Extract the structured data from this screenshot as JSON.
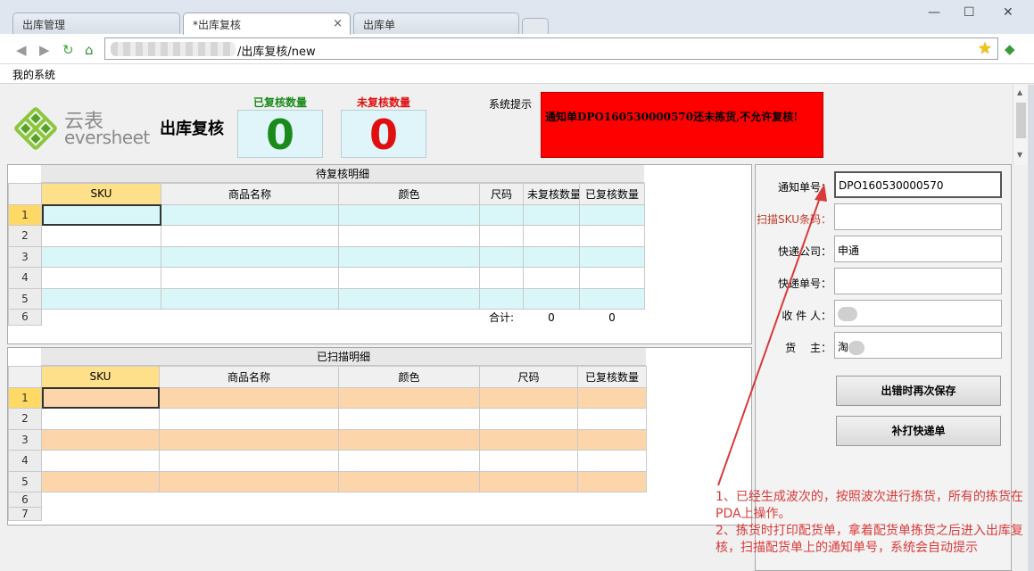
{
  "browser": {
    "tabs": [
      {
        "label": "出库管理"
      },
      {
        "label": "*出库复核"
      },
      {
        "label": "出库单"
      }
    ],
    "tab_close": "×",
    "url_text": "/出库复核/new",
    "bookmark": "我的系统",
    "window_controls": {
      "minimize": "—",
      "maximize": "☐",
      "close": "✕"
    }
  },
  "header": {
    "logo_cn": "云表",
    "logo_en": "eversheet",
    "title": "出库复核",
    "reviewed_label": "已复核数量",
    "reviewed_value": "0",
    "unreviewed_label": "未复核数量",
    "unreviewed_value": "0",
    "system_hint_label": "系统提示",
    "system_hint_text": "通知单DPO160530000570还未拣货,不允许复核!",
    "colors": {
      "reviewed": "#1a8a1a",
      "unreviewed": "#e01010",
      "alert_bg": "#ff0000"
    }
  },
  "pending_grid": {
    "title": "待复核明细",
    "columns": [
      "SKU",
      "商品名称",
      "颜色",
      "尺码",
      "未复核数量",
      "已复核数量"
    ],
    "row_numbers": [
      "1",
      "2",
      "3",
      "4",
      "5",
      "6"
    ],
    "total_label": "合计:",
    "total_unreviewed": "0",
    "total_reviewed": "0"
  },
  "scanned_grid": {
    "title": "已扫描明细",
    "columns": [
      "SKU",
      "商品名称",
      "颜色",
      "尺码",
      "已复核数量"
    ],
    "row_numbers": [
      "1",
      "2",
      "3",
      "4",
      "5",
      "6",
      "7"
    ]
  },
  "form": {
    "notice_no_label": "通知单号：",
    "notice_no_value": "DPO160530000570",
    "scan_sku_label": "扫描SKU条码：",
    "express_company_label": "快递公司：",
    "express_company_value": "申通",
    "express_no_label": "快递单号：",
    "express_no_value": "",
    "receiver_label": "收 件 人：",
    "owner_label": "货　 主：",
    "owner_value_partial": "淘",
    "save_again_button": "出错时再次保存",
    "reprint_button": "补打快递单"
  },
  "annotation": {
    "line1": "1、已经生成波次的，按照波次进行拣货，所有的拣货在PDA上操作。",
    "line2": "2、拣货时打印配货单，拿着配货单拣货之后进入出库复核，扫描配货单上的通知单号，系统会自动提示",
    "color": "#d93a3a"
  }
}
